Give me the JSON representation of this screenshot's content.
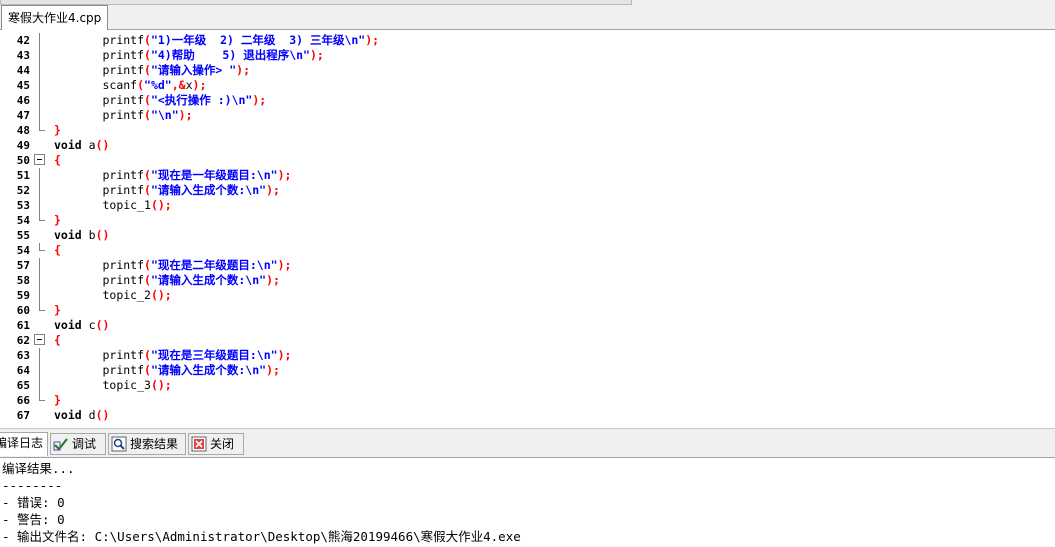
{
  "editor_tab": {
    "label": "寒假大作业4.cpp"
  },
  "code_lines": [
    {
      "num": "42",
      "fold": "line",
      "indent": "       ",
      "parts": [
        [
          "fn",
          "printf"
        ],
        [
          "pun",
          "("
        ],
        [
          "str",
          "\"1)一年级  2) 二年级  3) 三年级\\n\""
        ],
        [
          "pun",
          ");"
        ]
      ]
    },
    {
      "num": "43",
      "fold": "line",
      "indent": "       ",
      "parts": [
        [
          "fn",
          "printf"
        ],
        [
          "pun",
          "("
        ],
        [
          "str",
          "\"4)帮助    5) 退出程序\\n\""
        ],
        [
          "pun",
          ");"
        ]
      ]
    },
    {
      "num": "44",
      "fold": "line",
      "indent": "       ",
      "parts": [
        [
          "fn",
          "printf"
        ],
        [
          "pun",
          "("
        ],
        [
          "str",
          "\"请输入操作> \""
        ],
        [
          "pun",
          ");"
        ]
      ]
    },
    {
      "num": "45",
      "fold": "line",
      "indent": "       ",
      "parts": [
        [
          "fn",
          "scanf"
        ],
        [
          "pun",
          "("
        ],
        [
          "str",
          "\"%d\""
        ],
        [
          "pun",
          ",&"
        ],
        [
          "fn",
          "x"
        ],
        [
          "pun",
          ");"
        ]
      ]
    },
    {
      "num": "46",
      "fold": "line",
      "indent": "       ",
      "parts": [
        [
          "fn",
          "printf"
        ],
        [
          "pun",
          "("
        ],
        [
          "str",
          "\"<执行操作 :)\\n\""
        ],
        [
          "pun",
          ");"
        ]
      ]
    },
    {
      "num": "47",
      "fold": "line",
      "indent": "       ",
      "parts": [
        [
          "fn",
          "printf"
        ],
        [
          "pun",
          "("
        ],
        [
          "str",
          "\"\\n\""
        ],
        [
          "pun",
          ");"
        ]
      ]
    },
    {
      "num": "48",
      "fold": "end",
      "indent": "",
      "parts": [
        [
          "pun",
          "}"
        ]
      ]
    },
    {
      "num": "49",
      "fold": "none",
      "indent": "",
      "parts": [
        [
          "kw",
          "void"
        ],
        [
          "fn",
          " a"
        ],
        [
          "pun",
          "()"
        ]
      ]
    },
    {
      "num": "50",
      "fold": "box",
      "indent": "",
      "parts": [
        [
          "pun",
          "{"
        ]
      ]
    },
    {
      "num": "51",
      "fold": "line",
      "indent": "       ",
      "parts": [
        [
          "fn",
          "printf"
        ],
        [
          "pun",
          "("
        ],
        [
          "str",
          "\"现在是一年级题目:\\n\""
        ],
        [
          "pun",
          ");"
        ]
      ]
    },
    {
      "num": "52",
      "fold": "line",
      "indent": "       ",
      "parts": [
        [
          "fn",
          "printf"
        ],
        [
          "pun",
          "("
        ],
        [
          "str",
          "\"请输入生成个数:\\n\""
        ],
        [
          "pun",
          ");"
        ]
      ]
    },
    {
      "num": "53",
      "fold": "line",
      "indent": "       ",
      "parts": [
        [
          "fn",
          "topic_1"
        ],
        [
          "pun",
          "();"
        ]
      ]
    },
    {
      "num": "54",
      "fold": "end",
      "indent": "",
      "parts": [
        [
          "pun",
          "}"
        ]
      ]
    },
    {
      "num": "55",
      "fold": "none",
      "indent": "",
      "parts": [
        [
          "kw",
          "void"
        ],
        [
          "fn",
          " b"
        ],
        [
          "pun",
          "()"
        ]
      ]
    },
    {
      "num": "54",
      "fold": "end",
      "indent": "",
      "parts": [
        [
          "pun",
          "{"
        ]
      ]
    },
    {
      "num": "57",
      "fold": "line",
      "indent": "       ",
      "parts": [
        [
          "fn",
          "printf"
        ],
        [
          "pun",
          "("
        ],
        [
          "str",
          "\"现在是二年级题目:\\n\""
        ],
        [
          "pun",
          ");"
        ]
      ]
    },
    {
      "num": "58",
      "fold": "line",
      "indent": "       ",
      "parts": [
        [
          "fn",
          "printf"
        ],
        [
          "pun",
          "("
        ],
        [
          "str",
          "\"请输入生成个数:\\n\""
        ],
        [
          "pun",
          ");"
        ]
      ]
    },
    {
      "num": "59",
      "fold": "line",
      "indent": "       ",
      "parts": [
        [
          "fn",
          "topic_2"
        ],
        [
          "pun",
          "();"
        ]
      ]
    },
    {
      "num": "60",
      "fold": "end",
      "indent": "",
      "parts": [
        [
          "pun",
          "}"
        ]
      ]
    },
    {
      "num": "61",
      "fold": "none",
      "indent": "",
      "parts": [
        [
          "kw",
          "void"
        ],
        [
          "fn",
          " c"
        ],
        [
          "pun",
          "()"
        ]
      ]
    },
    {
      "num": "62",
      "fold": "box",
      "indent": "",
      "parts": [
        [
          "pun",
          "{"
        ]
      ]
    },
    {
      "num": "63",
      "fold": "line",
      "indent": "       ",
      "parts": [
        [
          "fn",
          "printf"
        ],
        [
          "pun",
          "("
        ],
        [
          "str",
          "\"现在是三年级题目:\\n\""
        ],
        [
          "pun",
          ");"
        ]
      ]
    },
    {
      "num": "64",
      "fold": "line",
      "indent": "       ",
      "parts": [
        [
          "fn",
          "printf"
        ],
        [
          "pun",
          "("
        ],
        [
          "str",
          "\"请输入生成个数:\\n\""
        ],
        [
          "pun",
          ");"
        ]
      ]
    },
    {
      "num": "65",
      "fold": "line",
      "indent": "       ",
      "parts": [
        [
          "fn",
          "topic_3"
        ],
        [
          "pun",
          "();"
        ]
      ]
    },
    {
      "num": "66",
      "fold": "end",
      "indent": "",
      "parts": [
        [
          "pun",
          "}"
        ]
      ]
    },
    {
      "num": "67",
      "fold": "none",
      "indent": "",
      "parts": [
        [
          "kw",
          "void"
        ],
        [
          "fn",
          " d"
        ],
        [
          "pun",
          "()"
        ]
      ]
    }
  ],
  "bottom_tabs": [
    {
      "label": "编译日志",
      "icon": "compile-log-icon",
      "active": true
    },
    {
      "label": "调试",
      "icon": "debug-check-icon",
      "active": false
    },
    {
      "label": "搜索结果",
      "icon": "search-results-icon",
      "active": false
    },
    {
      "label": "关闭",
      "icon": "close-panel-icon",
      "active": false
    }
  ],
  "output_lines": [
    "编译结果...",
    "--------",
    "- 错误: 0",
    "- 警告: 0",
    "- 输出文件名: C:\\Users\\Administrator\\Desktop\\熊海20199466\\寒假大作业4.exe"
  ]
}
